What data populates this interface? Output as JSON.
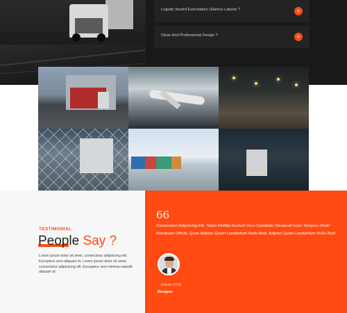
{
  "faq": {
    "items": [
      {
        "question": "Logistic Nostrd Exercitation Ullamco Laboris ?"
      },
      {
        "question": "Clean And Professional Design ?"
      }
    ],
    "toggle_symbol": "+"
  },
  "gallery": {
    "images": [
      {
        "subject": "red truck at loading dock"
      },
      {
        "subject": "cargo airplane on runway"
      },
      {
        "subject": "warehouse at night"
      },
      {
        "subject": "truck behind chain-link fence"
      },
      {
        "subject": "shipping containers at port"
      },
      {
        "subject": "truck on highway at dusk"
      }
    ]
  },
  "testimonial": {
    "eyebrow": "TESTIMONIAL",
    "heading_highlight": "Peop",
    "heading_rest": "le",
    "heading_accent": "Say ?",
    "body": "Lorem ipsum dolor sit amet, consectetur adipisicing elit. Excepteur vero aliquam id. Lorem ipsum dolor sit amet, consectetur adipisicing elit, Excepteur vero minima impedit aliquam id",
    "quote_mark": "66",
    "quote": "Consectetur Adipisicing Elit. Totam Mollitia Incidunt Vero Cupiditate Obcaecati Iusto Tempora Unde! Numquam Officiis, Quae Adipisci Quam Laudantium Nulla Illodi. Adipisci Quam Laudantium Nulla Illodi",
    "author": "- JOHN DOE",
    "role": "Designer"
  },
  "colors": {
    "accent": "#ff4a12",
    "dark": "#191919",
    "light_panel": "#f7f7f7"
  }
}
